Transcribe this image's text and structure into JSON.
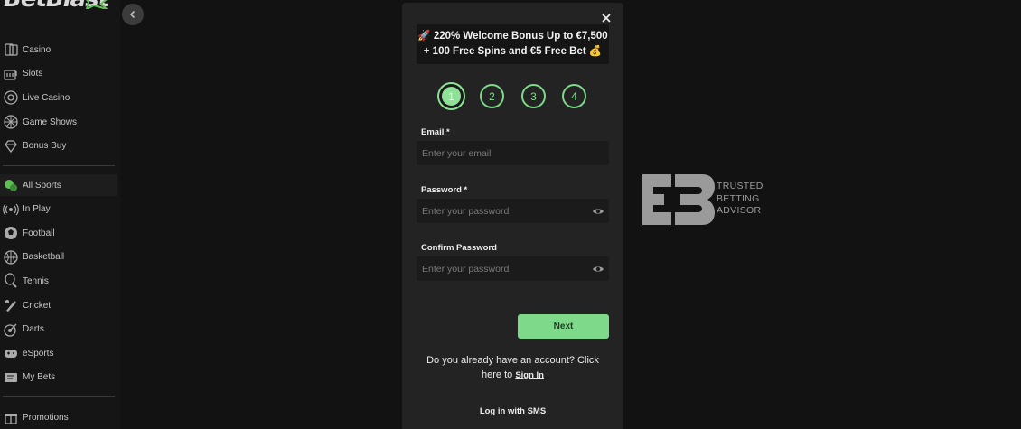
{
  "logo": {
    "text": "BetBlast"
  },
  "sidebar": {
    "casino_items": [
      {
        "label": "Casino",
        "icon": "cards-icon"
      },
      {
        "label": "Slots",
        "icon": "slot-machine-icon"
      },
      {
        "label": "Live Casino",
        "icon": "roulette-icon"
      },
      {
        "label": "Game Shows",
        "icon": "wheel-icon"
      },
      {
        "label": "Bonus Buy",
        "icon": "diamond-icon"
      }
    ],
    "sport_items": [
      {
        "label": "All Sports",
        "icon": "all-sports-icon"
      },
      {
        "label": "In Play",
        "icon": "live-signal-icon"
      },
      {
        "label": "Football",
        "icon": "football-icon"
      },
      {
        "label": "Basketball",
        "icon": "basketball-icon"
      },
      {
        "label": "Tennis",
        "icon": "tennis-icon"
      },
      {
        "label": "Cricket",
        "icon": "cricket-icon"
      },
      {
        "label": "Darts",
        "icon": "darts-icon"
      },
      {
        "label": "eSports",
        "icon": "gamepad-icon"
      },
      {
        "label": "My Bets",
        "icon": "ticket-icon"
      }
    ],
    "extra_items": [
      {
        "label": "Promotions",
        "icon": "gift-icon"
      }
    ]
  },
  "modal": {
    "promo_line1": "220% Welcome Bonus Up to €7,500",
    "promo_line2": "+ 100 Free Spins and €5 Free Bet",
    "promo_emoji_left": "🚀",
    "promo_emoji_right": "💰",
    "steps": [
      "1",
      "2",
      "3",
      "4"
    ],
    "active_step": 1,
    "email_label": "Email *",
    "email_placeholder": "Enter your email",
    "password_label": "Password *",
    "password_placeholder": "Enter your password",
    "confirm_label": "Confirm Password",
    "confirm_placeholder": "Enter your password",
    "next_label": "Next",
    "have_account_text": "Do you already have an account? Click here to",
    "sign_in_label": "Sign In",
    "sms_label": "Log in with SMS"
  },
  "badge": {
    "lines": [
      "TRUSTED",
      "BETTING",
      "ADVISOR"
    ]
  },
  "colors": {
    "accent": "#7fd98a",
    "background": "#121212",
    "modal": "#232323"
  }
}
